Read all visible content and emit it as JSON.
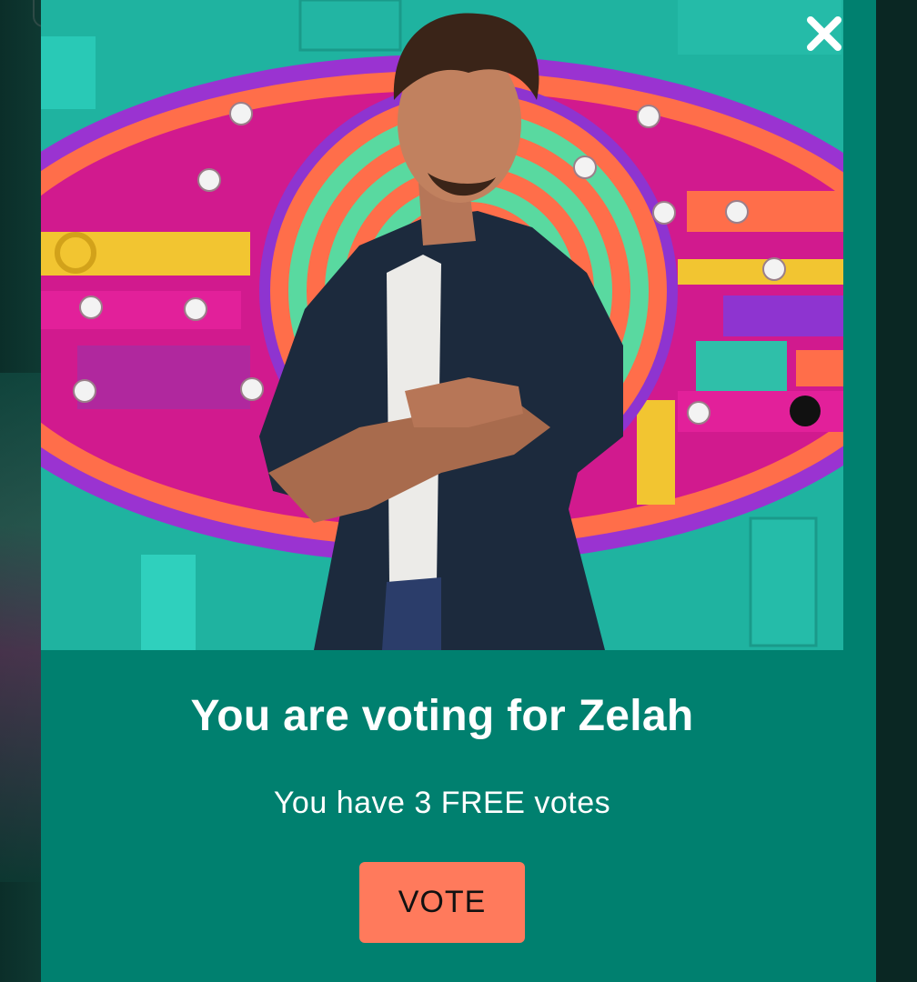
{
  "modal": {
    "title": "You are voting for Zelah",
    "subtitle": "You have 3 FREE votes",
    "vote_label": "VOTE",
    "close_icon": "close-icon",
    "hero_image": "housemate-portrait"
  },
  "colors": {
    "modal_bg": "#00806f",
    "hero_bg": "#21b8a6",
    "vote_button": "#ff7a5c",
    "text": "#ffffff"
  }
}
